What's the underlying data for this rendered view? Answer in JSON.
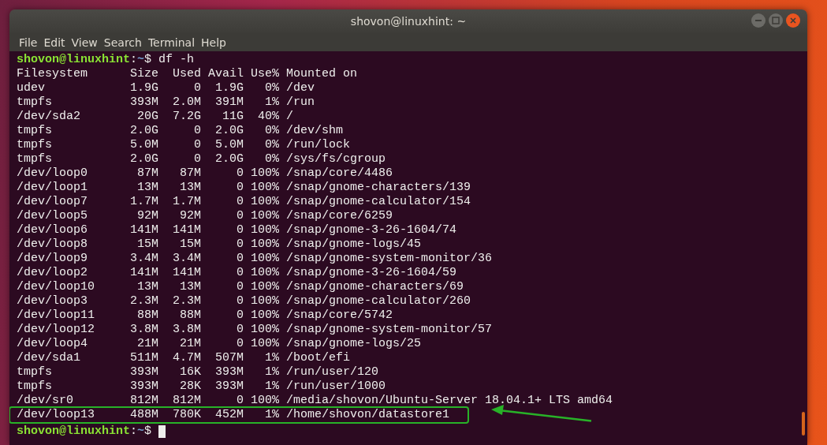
{
  "window": {
    "title": "shovon@linuxhint: ~"
  },
  "menu": [
    "File",
    "Edit",
    "View",
    "Search",
    "Terminal",
    "Help"
  ],
  "terminal": {
    "command_prompt": {
      "user_host": "shovon@linuxhint",
      "separator": ":",
      "path": "~",
      "sigil": "$",
      "command": "df -h"
    },
    "columns": [
      "Filesystem",
      "Size",
      "Used",
      "Avail",
      "Use%",
      "Mounted on"
    ],
    "rows": [
      {
        "cells": [
          "udev",
          "1.9G",
          "0",
          "1.9G",
          "0%",
          "/dev"
        ],
        "highlighted": false
      },
      {
        "cells": [
          "tmpfs",
          "393M",
          "2.0M",
          "391M",
          "1%",
          "/run"
        ],
        "highlighted": false
      },
      {
        "cells": [
          "/dev/sda2",
          "20G",
          "7.2G",
          "11G",
          "40%",
          "/"
        ],
        "highlighted": false
      },
      {
        "cells": [
          "tmpfs",
          "2.0G",
          "0",
          "2.0G",
          "0%",
          "/dev/shm"
        ],
        "highlighted": false
      },
      {
        "cells": [
          "tmpfs",
          "5.0M",
          "0",
          "5.0M",
          "0%",
          "/run/lock"
        ],
        "highlighted": false
      },
      {
        "cells": [
          "tmpfs",
          "2.0G",
          "0",
          "2.0G",
          "0%",
          "/sys/fs/cgroup"
        ],
        "highlighted": false
      },
      {
        "cells": [
          "/dev/loop0",
          "87M",
          "87M",
          "0",
          "100%",
          "/snap/core/4486"
        ],
        "highlighted": false
      },
      {
        "cells": [
          "/dev/loop1",
          "13M",
          "13M",
          "0",
          "100%",
          "/snap/gnome-characters/139"
        ],
        "highlighted": false
      },
      {
        "cells": [
          "/dev/loop7",
          "1.7M",
          "1.7M",
          "0",
          "100%",
          "/snap/gnome-calculator/154"
        ],
        "highlighted": false
      },
      {
        "cells": [
          "/dev/loop5",
          "92M",
          "92M",
          "0",
          "100%",
          "/snap/core/6259"
        ],
        "highlighted": false
      },
      {
        "cells": [
          "/dev/loop6",
          "141M",
          "141M",
          "0",
          "100%",
          "/snap/gnome-3-26-1604/74"
        ],
        "highlighted": false
      },
      {
        "cells": [
          "/dev/loop8",
          "15M",
          "15M",
          "0",
          "100%",
          "/snap/gnome-logs/45"
        ],
        "highlighted": false
      },
      {
        "cells": [
          "/dev/loop9",
          "3.4M",
          "3.4M",
          "0",
          "100%",
          "/snap/gnome-system-monitor/36"
        ],
        "highlighted": false
      },
      {
        "cells": [
          "/dev/loop2",
          "141M",
          "141M",
          "0",
          "100%",
          "/snap/gnome-3-26-1604/59"
        ],
        "highlighted": false
      },
      {
        "cells": [
          "/dev/loop10",
          "13M",
          "13M",
          "0",
          "100%",
          "/snap/gnome-characters/69"
        ],
        "highlighted": false
      },
      {
        "cells": [
          "/dev/loop3",
          "2.3M",
          "2.3M",
          "0",
          "100%",
          "/snap/gnome-calculator/260"
        ],
        "highlighted": false
      },
      {
        "cells": [
          "/dev/loop11",
          "88M",
          "88M",
          "0",
          "100%",
          "/snap/core/5742"
        ],
        "highlighted": false
      },
      {
        "cells": [
          "/dev/loop12",
          "3.8M",
          "3.8M",
          "0",
          "100%",
          "/snap/gnome-system-monitor/57"
        ],
        "highlighted": false
      },
      {
        "cells": [
          "/dev/loop4",
          "21M",
          "21M",
          "0",
          "100%",
          "/snap/gnome-logs/25"
        ],
        "highlighted": false
      },
      {
        "cells": [
          "/dev/sda1",
          "511M",
          "4.7M",
          "507M",
          "1%",
          "/boot/efi"
        ],
        "highlighted": false
      },
      {
        "cells": [
          "tmpfs",
          "393M",
          "16K",
          "393M",
          "1%",
          "/run/user/120"
        ],
        "highlighted": false
      },
      {
        "cells": [
          "tmpfs",
          "393M",
          "28K",
          "393M",
          "1%",
          "/run/user/1000"
        ],
        "highlighted": false
      },
      {
        "cells": [
          "/dev/sr0",
          "812M",
          "812M",
          "0",
          "100%",
          "/media/shovon/Ubuntu-Server 18.04.1+ LTS amd64"
        ],
        "highlighted": false
      },
      {
        "cells": [
          "/dev/loop13",
          "488M",
          "780K",
          "452M",
          "1%",
          "/home/shovon/datastore1"
        ],
        "highlighted": true
      }
    ],
    "final_prompt": {
      "user_host": "shovon@linuxhint",
      "separator": ":",
      "path": "~",
      "sigil": "$"
    }
  }
}
